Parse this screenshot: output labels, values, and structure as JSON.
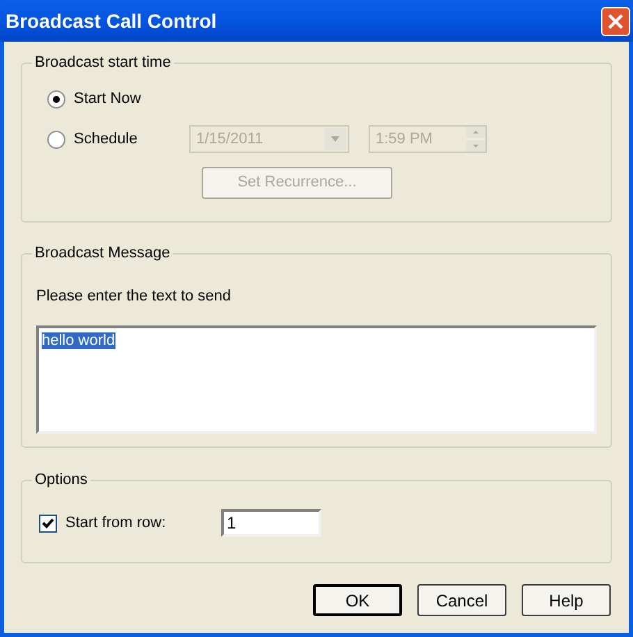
{
  "window": {
    "title": "Broadcast Call Control"
  },
  "start_time": {
    "title": "Broadcast start time",
    "options": [
      {
        "label": "Start Now",
        "selected": true
      },
      {
        "label": "Schedule",
        "selected": false
      }
    ],
    "schedule_disabled": true,
    "date": "1/15/2011",
    "time": "1:59 PM",
    "recurrence_button": "Set Recurrence..."
  },
  "message": {
    "title": "Broadcast Message",
    "prompt": "Please enter the text to send",
    "value": "hello world",
    "text_selected": true
  },
  "options": {
    "title": "Options",
    "checkbox": {
      "label": "Start from row:",
      "checked": true
    },
    "value": "1"
  },
  "buttons": [
    {
      "label": "OK",
      "default": true
    },
    {
      "label": "Cancel",
      "default": false
    },
    {
      "label": "Help",
      "default": false
    }
  ]
}
